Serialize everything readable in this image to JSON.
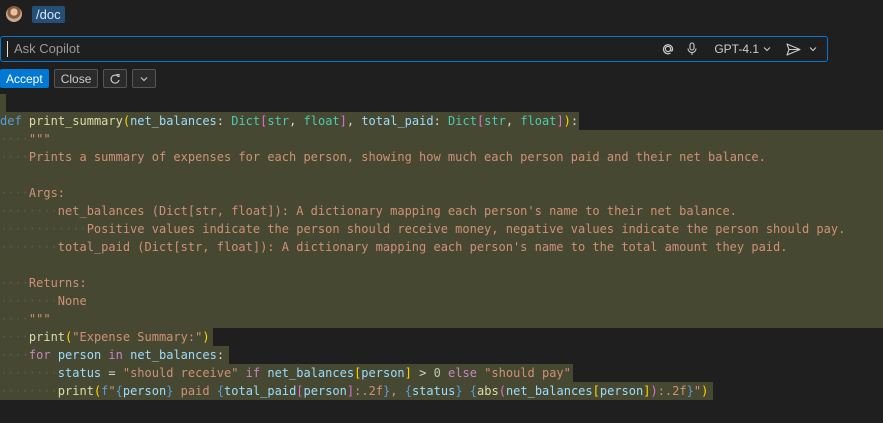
{
  "header": {
    "command": "/doc"
  },
  "input": {
    "placeholder": "Ask Copilot",
    "model": "GPT-4.1"
  },
  "actions": {
    "accept": "Accept",
    "close": "Close"
  },
  "icons": {
    "mention": "at-icon",
    "mic": "microphone-icon",
    "model_dropdown": "chevron-down-icon",
    "send": "send-icon",
    "send_dropdown": "chevron-down-icon",
    "rerun": "refresh-icon",
    "more": "chevron-down-icon"
  },
  "colors": {
    "accent": "#0078d4",
    "highlight": "#4a4b34",
    "background": "#1f1f1f"
  },
  "code": {
    "def_line": {
      "kw": "def",
      "name": "print_summary",
      "p1": "net_balances",
      "t1": "Dict",
      "p2": "total_paid",
      "t2": "Dict",
      "str_type": "str",
      "float_type": "float"
    },
    "docstring_open": "\"\"\"",
    "doc_summary": "Prints a summary of expenses for each person, showing how much each person paid and their net balance.",
    "doc_args": "Args:",
    "doc_arg1": "net_balances (Dict[str, float]): A dictionary mapping each person's name to their net balance.",
    "doc_arg1_cont": "Positive values indicate the person should receive money, negative values indicate the person should pay.",
    "doc_arg2": "total_paid (Dict[str, float]): A dictionary mapping each person's name to the total amount they paid.",
    "doc_returns": "Returns:",
    "doc_none": "None",
    "docstring_close": "\"\"\"",
    "print_call": "print",
    "print_arg": "\"Expense Summary:\"",
    "for_kw": "for",
    "for_var": "person",
    "in_kw": "in",
    "for_iter": "net_balances",
    "status_var": "status",
    "status_true": "\"should receive\"",
    "if_kw": "if",
    "status_cond": "net_balances",
    "status_idx": "person",
    "zero": "0",
    "else_kw": "else",
    "status_false": "\"should pay\"",
    "fprint": "print",
    "fprefix": "f",
    "f_person": "person",
    "f_paid": " paid ",
    "f_total": "total_paid",
    "f_fmt1": ":.2f",
    "f_status": "status",
    "f_abs": "abs",
    "f_nb": "net_balances",
    "f_fmt2": ":.2f"
  }
}
